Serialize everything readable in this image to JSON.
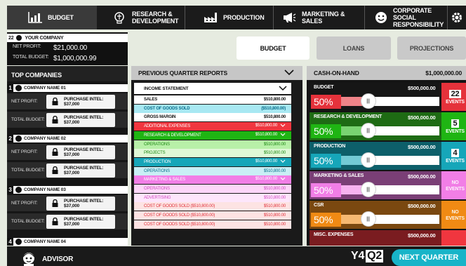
{
  "nav": {
    "tabs": [
      {
        "label": "BUDGET",
        "icon": "chart-icon"
      },
      {
        "label": "RESEARCH &\nDEVELOPMENT",
        "icon": "brain-icon"
      },
      {
        "label": "PRODUCTION",
        "icon": "factory-icon"
      },
      {
        "label": "MARKETING & SALES",
        "icon": "megaphone-icon"
      },
      {
        "label": "CORPORATE SOCIAL\nRESPONSIBILITY",
        "icon": "smile-icon"
      },
      {
        "label": "",
        "icon": "gear-icon"
      }
    ]
  },
  "company": {
    "number": "22",
    "name": "YOUR COMPANY",
    "net_profit_label": "NET PROFIT:",
    "net_profit": "$21,000.00",
    "total_budget_label": "TOTAL BUDGET:",
    "total_budget": "$1,000,000.99"
  },
  "tabs": {
    "budget": "BUDGET",
    "loans": "LOANS",
    "projections": "PROJECTIONS"
  },
  "top_companies": {
    "title": "TOP COMPANIES",
    "companies": [
      {
        "rank": "1",
        "name": "COMPANY NAME 01",
        "net_profit_label": "NET PROFIT:",
        "total_budget_label": "TOTAL BUDGET:",
        "intel1": "PURCHASE INTEL: $37,000",
        "intel2": "PURCHASE INTEL: $37,000"
      },
      {
        "rank": "2",
        "name": "COMPANY NAME 02",
        "net_profit_label": "NET PROFIT:",
        "total_budget_label": "TOTAL BUDGET:",
        "intel1": "PURCHASE INTEL: $37,000",
        "intel2": "PURCHASE INTEL: $37,000"
      },
      {
        "rank": "3",
        "name": "COMPANY NAME 03",
        "net_profit_label": "NET PROFIT:",
        "total_budget_label": "TOTAL BUDGET:",
        "intel1": "PURCHASE INTEL: $37,000",
        "intel2": "PURCHASE INTEL: $37,000"
      },
      {
        "rank": "4",
        "name": "COMPANY NAME 04"
      }
    ]
  },
  "reports": {
    "title": "PREVIOUS QUARTER REPORTS",
    "statement": "INCOME STATEMENT",
    "lines": [
      {
        "label": "SALES",
        "value": "$510,800.00",
        "bg": "#ffffff",
        "fg": "#111111",
        "chev": false
      },
      {
        "label": "COST OF GOODS SOLD",
        "value": "($510,800.00)",
        "bg": "#a8e8f2",
        "fg": "#0a6f8a",
        "chev": false
      },
      {
        "label": "GROSS MARGIN",
        "value": "$510,800.00",
        "bg": "#ffffff",
        "fg": "#111111",
        "chev": false
      },
      {
        "label": "ADDITIONAL EXPENSES",
        "value": "$510,800.00",
        "bg": "#f0363f",
        "fg": "#ffffff",
        "chev": true
      },
      {
        "label": "RESEARCH & DEVELOPMENT",
        "value": "$510,800.00",
        "bg": "#1fb513",
        "fg": "#ffffff",
        "chev": true
      },
      {
        "label": "OPERATIONS",
        "value": "$510,800.00",
        "bg": "#b8f0a8",
        "fg": "#1e8a14",
        "chev": false
      },
      {
        "label": "PROJECTS",
        "value": "$510,800.00",
        "bg": "#e0f8d6",
        "fg": "#1e8a14",
        "chev": false
      },
      {
        "label": "PRODUCTION",
        "value": "$510,800.00",
        "bg": "#16a6b9",
        "fg": "#ffffff",
        "chev": true
      },
      {
        "label": "OPERATIONS",
        "value": "$510,800.00",
        "bg": "#c9eff5",
        "fg": "#0a6f8a",
        "chev": false
      },
      {
        "label": "MARKETING & SALES",
        "value": "$510,800.00",
        "bg": "#f17ee6",
        "fg": "#ffffff",
        "chev": true
      },
      {
        "label": "OPERATIONS",
        "value": "$510,800.00",
        "bg": "#fcd6f8",
        "fg": "#d34cc4",
        "chev": false
      },
      {
        "label": "ADVERTISING",
        "value": "$510,800.00",
        "bg": "#fde6fb",
        "fg": "#d34cc4",
        "chev": false
      },
      {
        "label": "COST OF GOODS SOLD ($510,800.00)",
        "value": "$510,800.00",
        "bg": "#fde3e3",
        "fg": "#e0323b",
        "chev": false
      },
      {
        "label": "COST OF GOODS SOLD ($510,800.00)",
        "value": "$510,800.00",
        "bg": "#fde3e3",
        "fg": "#e0323b",
        "chev": false
      },
      {
        "label": "COST OF GOODS SOLD ($510,800.00)",
        "value": "$510,800.00",
        "bg": "#fde3e3",
        "fg": "#e0323b",
        "chev": false
      }
    ]
  },
  "cash": {
    "title": "CASH-ON-HAND",
    "amount": "$1,000,000.00",
    "categories": [
      {
        "name": "BUDGET",
        "amount": "$500,000.00",
        "percent": "50%",
        "level": 0.5,
        "events": "22",
        "events_label": "EVENTS",
        "color": "#e5323b",
        "dark": "#161616",
        "pctcolor": "#e5323b"
      },
      {
        "name": "RESEARCH & DEVELOPMENT",
        "amount": "$500,000.00",
        "percent": "50%",
        "level": 0.5,
        "events": "5",
        "events_label": "EVENTS",
        "color": "#1fb513",
        "dark": "#1e6b14",
        "pctcolor": "#1fb513"
      },
      {
        "name": "PRODUCTION",
        "amount": "$500,000.00",
        "percent": "50%",
        "level": 0.5,
        "events": "4",
        "events_label": "EVENTS",
        "color": "#16a6b9",
        "dark": "#0d5f6a",
        "pctcolor": "#16a6b9"
      },
      {
        "name": "MARKETING & SALES",
        "amount": "$500,000.00",
        "percent": "50%",
        "level": 0.5,
        "events": "",
        "events_label": "NO\nEVENTS",
        "color": "#f17ee6",
        "dark": "#7a3f76",
        "pctcolor": "#f17ee6"
      },
      {
        "name": "CSR",
        "amount": "$500,000.00",
        "percent": "50%",
        "level": 0.5,
        "events": "",
        "events_label": "NO\nEVENTS",
        "color": "#f08a14",
        "dark": "#7a4810",
        "pctcolor": "#f08a14"
      },
      {
        "name": "MISC. EXPENSES",
        "amount": "$500,000.00",
        "percent": "",
        "level": 0.5,
        "events": "",
        "events_label": "",
        "color": "#f0363f",
        "dark": "#7a1c20",
        "pctcolor": "#f0363f"
      }
    ]
  },
  "footer": {
    "advisor": "ADVISOR",
    "year": "Y4",
    "quarter": "Q2",
    "next": "NEXT QUARTER"
  }
}
